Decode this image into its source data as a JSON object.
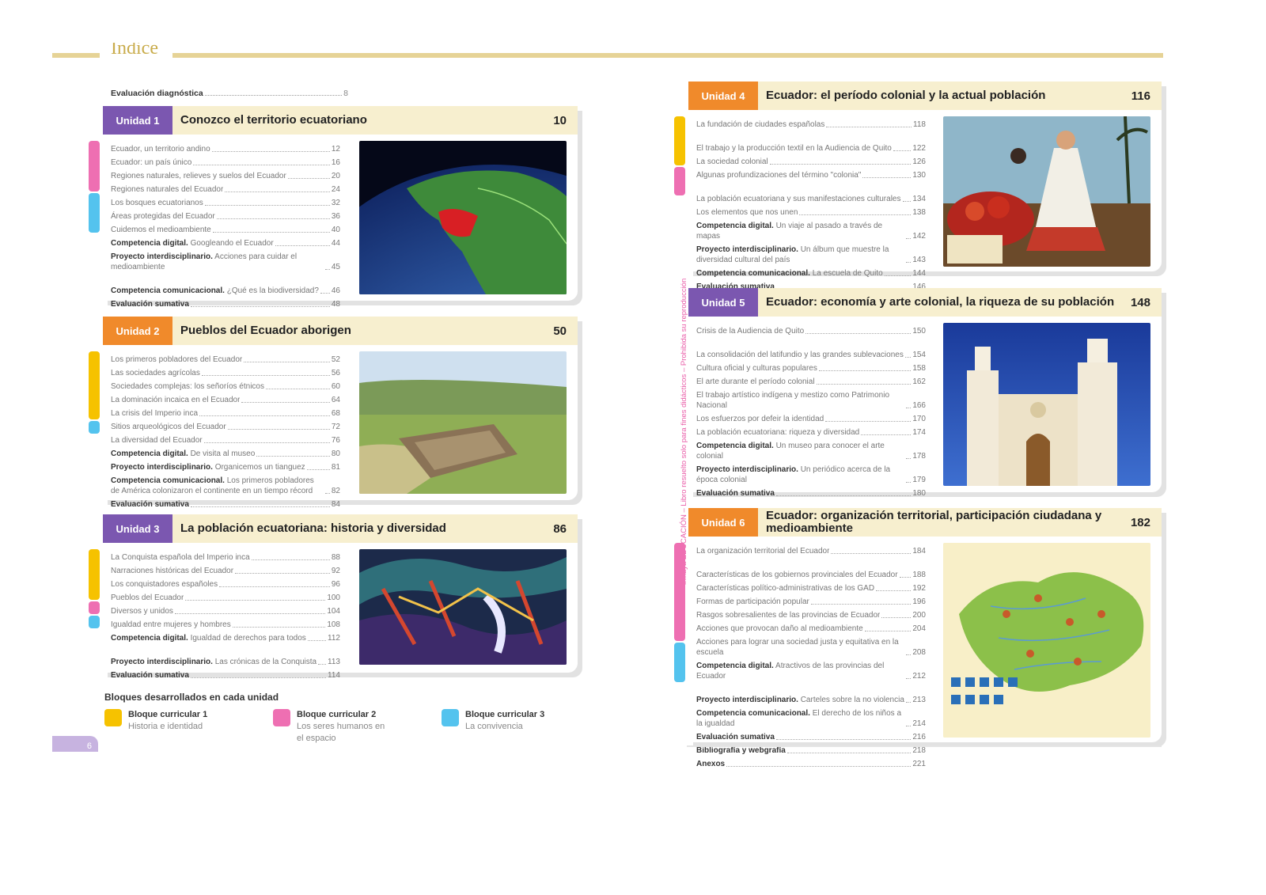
{
  "header": {
    "title": "Índice",
    "left_page_number": "6"
  },
  "diagnostic": {
    "label": "Evaluación diagnóstica",
    "page": "8"
  },
  "side_note": "©maya EDUCACIÓN – Libro resuelto solo para fines didácticos – Prohibida su reproducción",
  "units": [
    {
      "badge": "Unidad 1",
      "title": "Conozco el territorio ecuatoriano",
      "page": "10",
      "badge_color": "#7b57b0",
      "items": [
        {
          "label": "Ecuador, un territorio andino",
          "page": "12"
        },
        {
          "label": "Ecuador: un país único",
          "page": "16"
        },
        {
          "label": "Regiones naturales, relieves y suelos del Ecuador",
          "page": "20"
        },
        {
          "label": "Regiones naturales del Ecuador",
          "page": "24"
        },
        {
          "label": "Los bosques ecuatorianos",
          "page": "32"
        },
        {
          "label": "Áreas protegidas del Ecuador",
          "page": "36"
        },
        {
          "label": "Cuidemos el medioambiente",
          "page": "40"
        },
        {
          "bold": "Competencia digital.",
          "label": " Googleando el Ecuador",
          "page": "44"
        },
        {
          "bold": "Proyecto interdisciplinario.",
          "label": " Acciones para cuidar el medioambiente",
          "page": "45"
        },
        {
          "bold": "Competencia comunicacional.",
          "label": " ¿Qué es la biodiversidad?",
          "page": "46"
        },
        {
          "bold": "Evaluación sumativa",
          "label": "",
          "page": "48"
        }
      ]
    },
    {
      "badge": "Unidad 2",
      "title": "Pueblos del Ecuador aborigen",
      "page": "50",
      "badge_color": "#f08a2b",
      "items": [
        {
          "label": "Los primeros pobladores del Ecuador",
          "page": "52"
        },
        {
          "label": "Las sociedades agrícolas",
          "page": "56"
        },
        {
          "label": "Sociedades complejas: los señoríos étnicos",
          "page": "60"
        },
        {
          "label": "La dominación incaica en el Ecuador",
          "page": "64"
        },
        {
          "label": "La crisis del Imperio inca",
          "page": "68"
        },
        {
          "label": "Sitios arqueológicos del Ecuador",
          "page": "72"
        },
        {
          "label": "La diversidad del Ecuador",
          "page": "76"
        },
        {
          "bold": "Competencia digital.",
          "label": " De visita al museo",
          "page": "80"
        },
        {
          "bold": "Proyecto interdisciplinario.",
          "label": " Organicemos un tianguez",
          "page": "81"
        },
        {
          "bold": "Competencia comunicacional.",
          "label": " Los primeros pobladores de América colonizaron el continente en un tiempo récord",
          "page": "82"
        },
        {
          "bold": "Evaluación sumativa",
          "label": "",
          "page": "84"
        }
      ]
    },
    {
      "badge": "Unidad 3",
      "title": "La población ecuatoriana: historia y diversidad",
      "page": "86",
      "badge_color": "#7b57b0",
      "items": [
        {
          "label": "La Conquista española del Imperio inca",
          "page": "88"
        },
        {
          "label": "Narraciones históricas del Ecuador",
          "page": "92"
        },
        {
          "label": "Los conquistadores españoles",
          "page": "96"
        },
        {
          "label": "Pueblos del Ecuador",
          "page": "100"
        },
        {
          "label": "Diversos y unidos",
          "page": "104"
        },
        {
          "label": "Igualdad entre mujeres y hombres",
          "page": "108"
        },
        {
          "bold": "Competencia digital.",
          "label": " Igualdad de derechos para todos",
          "page": "112"
        },
        {
          "bold": "Proyecto interdisciplinario.",
          "label": " Las crónicas de la Conquista",
          "page": "113"
        },
        {
          "bold": "Evaluación sumativa",
          "label": "",
          "page": "114"
        }
      ]
    },
    {
      "badge": "Unidad 4",
      "title": "Ecuador: el período colonial y la actual población",
      "page": "116",
      "badge_color": "#f08a2b",
      "items": [
        {
          "label": "La fundación de ciudades españolas",
          "page": "118"
        },
        {
          "label": "El trabajo y la producción textil en la Audiencia de Quito",
          "page": "122"
        },
        {
          "label": "La sociedad colonial",
          "page": "126"
        },
        {
          "label": "Algunas profundizaciones del término \"colonia\"",
          "page": "130"
        },
        {
          "label": "La población ecuatoriana y sus manifestaciones culturales",
          "page": "134"
        },
        {
          "label": "Los elementos que nos unen",
          "page": "138"
        },
        {
          "bold": "Competencia digital.",
          "label": " Un viaje al pasado a través de mapas",
          "page": "142"
        },
        {
          "bold": "Proyecto interdisciplinario.",
          "label": " Un álbum que muestre la diversidad cultural del país",
          "page": "143"
        },
        {
          "bold": "Competencia comunicacional.",
          "label": " La escuela de Quito",
          "page": "144"
        },
        {
          "bold": "Evaluación sumativa",
          "label": "",
          "page": "146"
        }
      ]
    },
    {
      "badge": "Unidad 5",
      "title": "Ecuador: economía y arte colonial, la riqueza de su población",
      "page": "148",
      "badge_color": "#7b57b0",
      "items": [
        {
          "label": "Crisis de la Audiencia de Quito",
          "page": "150"
        },
        {
          "label": "La consolidación del latifundio y las grandes sublevaciones",
          "page": "154"
        },
        {
          "label": "Cultura oficial y culturas populares",
          "page": "158"
        },
        {
          "label": "El arte durante el período colonial",
          "page": "162"
        },
        {
          "label": "El trabajo artístico indígena y mestizo como Patrimonio Nacional",
          "page": "166"
        },
        {
          "label": "Los esfuerzos por defeir la identidad",
          "page": "170"
        },
        {
          "label": "La población ecuatoriana: riqueza y diversidad",
          "page": "174"
        },
        {
          "bold": "Competencia digital.",
          "label": " Un museo para conocer el arte colonial",
          "page": "178"
        },
        {
          "bold": "Proyecto interdisciplinario.",
          "label": " Un periódico acerca de la época colonial",
          "page": "179"
        },
        {
          "bold": "Evaluación sumativa",
          "label": "",
          "page": "180"
        }
      ]
    },
    {
      "badge": "Unidad 6",
      "title": "Ecuador: organización territorial, participación ciudadana y medioambiente",
      "page": "182",
      "badge_color": "#f08a2b",
      "items": [
        {
          "label": "La organización territorial del Ecuador",
          "page": "184"
        },
        {
          "label": "Características de los gobiernos provinciales del Ecuador",
          "page": "188"
        },
        {
          "label": "Características político-administrativas de los GAD",
          "page": "192"
        },
        {
          "label": "Formas de participación popular",
          "page": "196"
        },
        {
          "label": "Rasgos sobresalientes de las provincias de Ecuador",
          "page": "200"
        },
        {
          "label": "Acciones que provocan daño al medioambiente",
          "page": "204"
        },
        {
          "label": "Acciones para lograr una sociedad justa y equitativa en la escuela",
          "page": "208"
        },
        {
          "bold": "Competencia digital.",
          "label": " Atractivos de las provincias del Ecuador",
          "page": "212"
        },
        {
          "bold": "Proyecto interdisciplinario.",
          "label": " Carteles sobre la no violencia",
          "page": "213"
        },
        {
          "bold": "Competencia comunicacional.",
          "label": " El derecho de los niños a la igualdad",
          "page": "214"
        },
        {
          "bold": "Evaluación sumativa",
          "label": "",
          "page": "216"
        },
        {
          "bold": "Bibliografía y webgrafía",
          "label": "",
          "page": "218"
        },
        {
          "bold": "Anexos",
          "label": "",
          "page": "221"
        }
      ]
    }
  ],
  "legend": {
    "title": "Bloques desarrollados en cada unidad",
    "blocks": [
      {
        "name": "Bloque curricular 1",
        "desc": "Historia e identidad",
        "color": "#f6c200"
      },
      {
        "name": "Bloque curricular 2",
        "desc": "Los seres humanos en el espacio",
        "color": "#ee6fb2"
      },
      {
        "name": "Bloque curricular 3",
        "desc": "La convivencia",
        "color": "#54c3ee"
      }
    ]
  },
  "colors": {
    "yellow": "#f6c200",
    "pink": "#ee6fb2",
    "blue": "#54c3ee",
    "purple": "#7b57b0",
    "orange": "#f08a2b",
    "header_band": "#f7efcf",
    "gold_line": "#e6d396"
  }
}
